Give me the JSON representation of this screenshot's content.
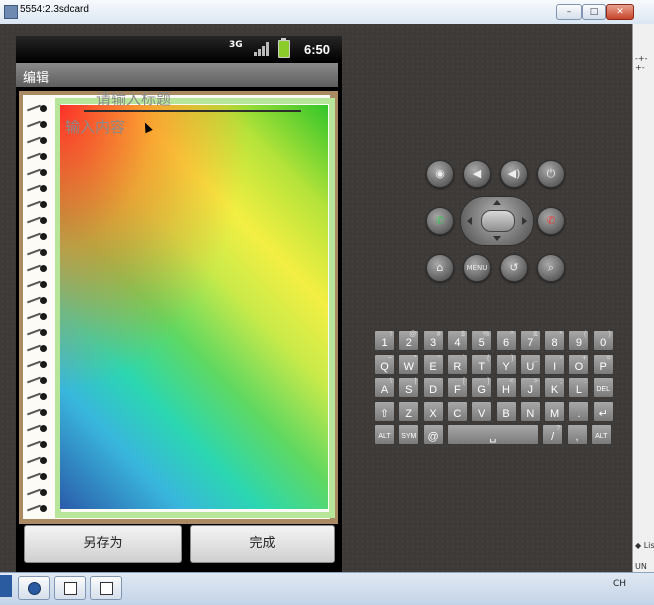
{
  "window": {
    "title": "5554:2.3sdcard",
    "min_label": "–",
    "max_label": "□",
    "close_label": "✕"
  },
  "status_bar": {
    "network": "3G",
    "time": "6:50"
  },
  "app": {
    "title": "编辑"
  },
  "editor": {
    "title_placeholder": "请输入标题",
    "content_placeholder": "输入内容",
    "save_as_label": "另存为",
    "done_label": "完成"
  },
  "controls": {
    "camera_icon": "◉",
    "vol_down_icon": "◀",
    "vol_up_icon": "◀)",
    "power_icon": "⏻",
    "call_icon": "✆",
    "end_icon": "✆",
    "home_icon": "⌂",
    "menu_label": "MENU",
    "back_icon": "↺",
    "search_icon": "⌕"
  },
  "keyboard": {
    "rows": [
      [
        {
          "k": "1",
          "a": "!"
        },
        {
          "k": "2",
          "a": "@"
        },
        {
          "k": "3",
          "a": "#"
        },
        {
          "k": "4",
          "a": "$"
        },
        {
          "k": "5",
          "a": "%"
        },
        {
          "k": "6",
          "a": "^"
        },
        {
          "k": "7",
          "a": "&"
        },
        {
          "k": "8",
          "a": "*"
        },
        {
          "k": "9",
          "a": "("
        },
        {
          "k": "0",
          "a": ")"
        }
      ],
      [
        {
          "k": "Q",
          "a": "~"
        },
        {
          "k": "W",
          "a": "\""
        },
        {
          "k": "E",
          "a": "\""
        },
        {
          "k": "R",
          "a": "`"
        },
        {
          "k": "T",
          "a": "{"
        },
        {
          "k": "Y",
          "a": "}"
        },
        {
          "k": "U",
          "a": "_"
        },
        {
          "k": "I",
          "a": "-"
        },
        {
          "k": "O",
          "a": "+"
        },
        {
          "k": "P",
          "a": "="
        }
      ],
      [
        {
          "k": "A",
          "a": "\\"
        },
        {
          "k": "S",
          "a": "|"
        },
        {
          "k": "D",
          "a": ""
        },
        {
          "k": "F",
          "a": "["
        },
        {
          "k": "G",
          "a": "]"
        },
        {
          "k": "H",
          "a": "<"
        },
        {
          "k": "J",
          "a": ">"
        },
        {
          "k": "K",
          "a": ";"
        },
        {
          "k": "L",
          "a": ":"
        },
        {
          "k": "DEL",
          "a": ""
        }
      ],
      [
        {
          "k": "⇧",
          "a": ""
        },
        {
          "k": "Z",
          "a": ""
        },
        {
          "k": "X",
          "a": ""
        },
        {
          "k": "C",
          "a": ""
        },
        {
          "k": "V",
          "a": ""
        },
        {
          "k": "B",
          "a": ""
        },
        {
          "k": "N",
          "a": ""
        },
        {
          "k": "M",
          "a": ""
        },
        {
          "k": ".",
          "a": ""
        },
        {
          "k": "↵",
          "a": ""
        }
      ],
      [
        {
          "k": "ALT",
          "a": ""
        },
        {
          "k": "SYM",
          "a": ""
        },
        {
          "k": "@",
          "a": ""
        },
        {
          "k": "␣",
          "a": ""
        },
        {
          "k": "/",
          "a": "?"
        },
        {
          "k": ",",
          "a": ""
        },
        {
          "k": "ALT",
          "a": ""
        }
      ]
    ]
  },
  "side_panel": {
    "line_top": "-+-+-",
    "line_list": "◆ Lis",
    "line_un": "UN"
  },
  "taskbar": {
    "tray": "CH"
  }
}
